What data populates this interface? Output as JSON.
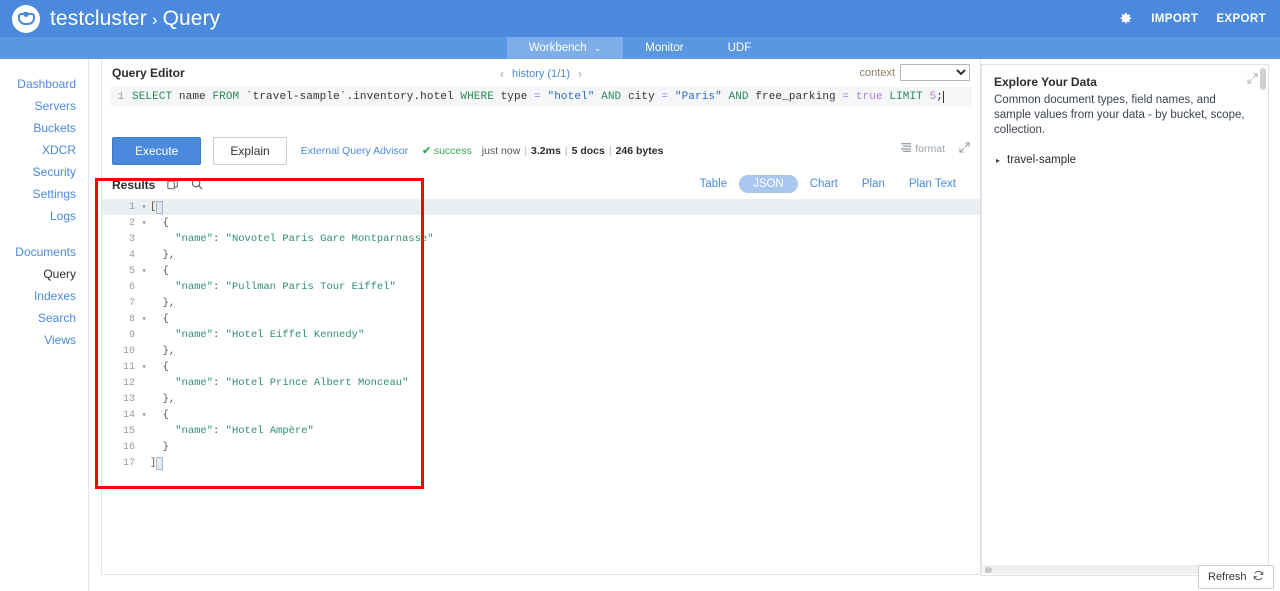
{
  "header": {
    "logo_icon": "couchbase-logo-icon",
    "cluster_name": "testcluster",
    "separator": "›",
    "section": "Query",
    "gear_icon": "gear-icon",
    "import_label": "IMPORT",
    "export_label": "EXPORT"
  },
  "subnav": {
    "items": [
      {
        "label": "Workbench",
        "caret": "⌄",
        "active": true
      },
      {
        "label": "Monitor",
        "active": false
      },
      {
        "label": "UDF",
        "active": false
      }
    ]
  },
  "sidebar": {
    "group1": [
      {
        "label": "Dashboard"
      },
      {
        "label": "Servers"
      },
      {
        "label": "Buckets"
      },
      {
        "label": "XDCR"
      },
      {
        "label": "Security"
      },
      {
        "label": "Settings"
      },
      {
        "label": "Logs"
      }
    ],
    "group2": [
      {
        "label": "Documents"
      },
      {
        "label": "Query",
        "selected": true
      },
      {
        "label": "Indexes"
      },
      {
        "label": "Search"
      },
      {
        "label": "Views"
      }
    ]
  },
  "editor": {
    "title": "Query Editor",
    "history_prev": "‹",
    "history_label": "history (1/1)",
    "history_next": "›",
    "context_label": "context",
    "context_value": "",
    "line_number": "1",
    "query_tokens": [
      {
        "t": "SELECT",
        "c": "kw"
      },
      {
        "t": " name ",
        "c": "id"
      },
      {
        "t": "FROM",
        "c": "kw"
      },
      {
        "t": " `travel-sample`.inventory.hotel ",
        "c": "id"
      },
      {
        "t": "WHERE",
        "c": "kw"
      },
      {
        "t": " type ",
        "c": "id"
      },
      {
        "t": "=",
        "c": "op"
      },
      {
        "t": " ",
        "c": "id"
      },
      {
        "t": "\"hotel\"",
        "c": "str"
      },
      {
        "t": " ",
        "c": "id"
      },
      {
        "t": "AND",
        "c": "kw"
      },
      {
        "t": " city ",
        "c": "id"
      },
      {
        "t": "=",
        "c": "op"
      },
      {
        "t": " ",
        "c": "id"
      },
      {
        "t": "\"Paris\"",
        "c": "str"
      },
      {
        "t": " ",
        "c": "id"
      },
      {
        "t": "AND",
        "c": "kw"
      },
      {
        "t": " free_parking ",
        "c": "id"
      },
      {
        "t": "=",
        "c": "op"
      },
      {
        "t": " ",
        "c": "id"
      },
      {
        "t": "true",
        "c": "bool"
      },
      {
        "t": " ",
        "c": "id"
      },
      {
        "t": "LIMIT",
        "c": "kw"
      },
      {
        "t": " ",
        "c": "id"
      },
      {
        "t": "5",
        "c": "num"
      },
      {
        "t": ";",
        "c": "id"
      }
    ],
    "query_text": "SELECT name FROM `travel-sample`.inventory.hotel WHERE type = \"hotel\" AND city = \"Paris\" AND free_parking = true LIMIT 5;"
  },
  "actions": {
    "execute_label": "Execute",
    "explain_label": "Explain",
    "advisor_label": "External Query Advisor",
    "status_check": "✔",
    "status_label": "success",
    "time_ago": "just now",
    "elapsed": "3.2ms",
    "docs": "5 docs",
    "bytes": "246 bytes",
    "format_label": "format",
    "format_icon": "format-lines-icon",
    "expand_icon": "expand-arrows-icon"
  },
  "results": {
    "title": "Results",
    "copy_icon": "copy-icon",
    "search_icon": "search-icon",
    "tabs": [
      {
        "label": "Table",
        "active": false
      },
      {
        "label": "JSON",
        "active": true
      },
      {
        "label": "Chart",
        "active": false
      },
      {
        "label": "Plan",
        "active": false
      },
      {
        "label": "Plan Text",
        "active": false
      }
    ],
    "json_lines": [
      {
        "n": "1",
        "fold": "▾",
        "code": "[",
        "hl": true,
        "cursor": true
      },
      {
        "n": "2",
        "fold": "▾",
        "code": "  {"
      },
      {
        "n": "3",
        "fold": "",
        "code": "    \"name\": \"Novotel Paris Gare Montparnasse\"",
        "str": true
      },
      {
        "n": "4",
        "fold": "",
        "code": "  },"
      },
      {
        "n": "5",
        "fold": "▾",
        "code": "  {"
      },
      {
        "n": "6",
        "fold": "",
        "code": "    \"name\": \"Pullman Paris Tour Eiffel\"",
        "str": true
      },
      {
        "n": "7",
        "fold": "",
        "code": "  },"
      },
      {
        "n": "8",
        "fold": "▾",
        "code": "  {"
      },
      {
        "n": "9",
        "fold": "",
        "code": "    \"name\": \"Hotel Eiffel Kennedy\"",
        "str": true
      },
      {
        "n": "10",
        "fold": "",
        "code": "  },"
      },
      {
        "n": "11",
        "fold": "▾",
        "code": "  {"
      },
      {
        "n": "12",
        "fold": "",
        "code": "    \"name\": \"Hotel Prince Albert Monceau\"",
        "str": true
      },
      {
        "n": "13",
        "fold": "",
        "code": "  },"
      },
      {
        "n": "14",
        "fold": "▾",
        "code": "  {"
      },
      {
        "n": "15",
        "fold": "",
        "code": "    \"name\": \"Hotel Ampère\"",
        "str": true
      },
      {
        "n": "16",
        "fold": "",
        "code": "  }"
      },
      {
        "n": "17",
        "fold": "",
        "code": "]",
        "boxcursor": true
      }
    ]
  },
  "explore": {
    "title": "Explore Your Data",
    "description": "Common document types, field names, and sample values from your data - by bucket, scope, collection.",
    "expand_icon": "expand-arrows-icon",
    "tree": [
      {
        "label": "travel-sample",
        "caret": "▸"
      }
    ]
  },
  "refresh": {
    "label": "Refresh",
    "icon": "refresh-icon"
  },
  "colors": {
    "brand_blue": "#4A89DC",
    "subnav_blue": "#5B96E0",
    "highlight_red": "#FF0000",
    "success_green": "#3aa655",
    "json_string_green": "#2f8f6d"
  }
}
